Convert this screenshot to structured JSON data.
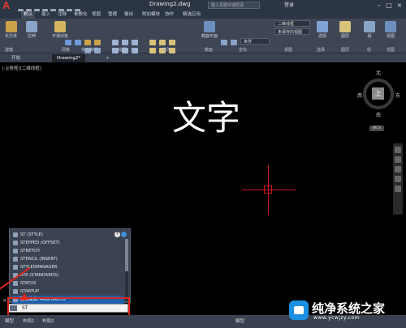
{
  "app": {
    "logo": "A",
    "document_title": "Drawing2.dwg",
    "search_placeholder": "键入关键字或短语",
    "login_label": "登录"
  },
  "ribbon_tabs": [
    "默认",
    "插入",
    "注释",
    "参数化",
    "视图",
    "管理",
    "输出",
    "附加模块",
    "协作",
    "精选应用"
  ],
  "ribbon": {
    "buttons": [
      "长方体",
      "拉伸",
      "平滑对象",
      "网格",
      "剖切",
      "截面平面",
      "二维线框",
      "未保存的视图",
      "世界",
      "图层",
      "视图",
      "选择",
      "组",
      "视图"
    ],
    "groups": [
      "建模",
      "网格",
      "实体编辑",
      "绘图",
      "修改",
      "截面",
      "坐标",
      "视图",
      "选择",
      "图层",
      "组",
      "视图"
    ]
  },
  "file_tabs": {
    "start": "开始",
    "current": "Drawing2*",
    "add": "+"
  },
  "viewport": {
    "label": "[-][俯视][二维线框]",
    "canvas_text": "文字"
  },
  "viewcube": {
    "face": "上",
    "north": "北",
    "south": "南",
    "east": "东",
    "west": "西",
    "wcs": "WCS"
  },
  "autocomplete": {
    "items": [
      "ST (STYLE)",
      "STEPPED (OFFSET)",
      "STRETCH",
      "STENCIL (INSERT)",
      "STYLESMANAGER",
      "STA (STANDARDS)",
      "STATUS",
      "STARTUP",
      "图案填充: ANSI BRSTD"
    ],
    "help": "?"
  },
  "command_line": {
    "value": "ST",
    "close": "×"
  },
  "status_bar": {
    "tabs": [
      "模型",
      "布局1",
      "布局2"
    ],
    "model_label": "模型"
  },
  "watermark": {
    "title": "纯净系统之家",
    "url": "www.ycwjzy.com"
  },
  "colors": {
    "accent_red": "#e1251b",
    "crosshair": "#d0191e",
    "selection": "#1f5ea8",
    "ribbon_bg": "#3e4656"
  }
}
